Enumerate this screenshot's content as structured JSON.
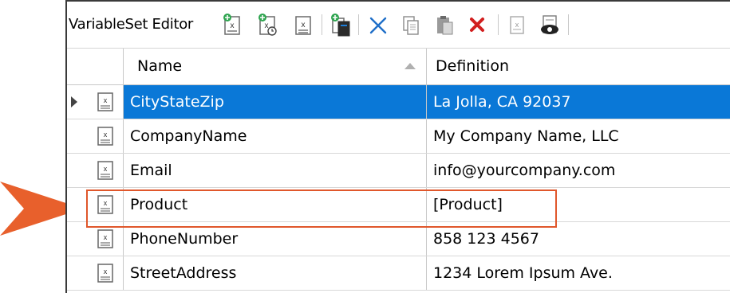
{
  "toolbar": {
    "title": "VariableSet Editor",
    "buttons": [
      {
        "name": "new-variable-icon"
      },
      {
        "name": "new-datetime-variable-icon"
      },
      {
        "name": "variable-icon"
      },
      {
        "name": "import-variables-icon"
      },
      {
        "name": "cut-icon"
      },
      {
        "name": "copy-icon"
      },
      {
        "name": "paste-icon"
      },
      {
        "name": "delete-icon"
      },
      {
        "name": "properties-icon"
      },
      {
        "name": "preview-icon"
      }
    ]
  },
  "grid": {
    "columns": {
      "name": "Name",
      "definition": "Definition"
    },
    "rows": [
      {
        "name": "CityStateZip",
        "definition": "La Jolla, CA 92037"
      },
      {
        "name": "CompanyName",
        "definition": "My Company Name, LLC"
      },
      {
        "name": "Email",
        "definition": "info@yourcompany.com"
      },
      {
        "name": "Product",
        "definition": "[Product]"
      },
      {
        "name": "PhoneNumber",
        "definition": "858 123 4567"
      },
      {
        "name": "StreetAddress",
        "definition": "1234 Lorem Ipsum Ave."
      }
    ]
  },
  "colors": {
    "selection": "#0a78d7",
    "highlight": "#e0572b",
    "arrow": "#e8602c"
  }
}
